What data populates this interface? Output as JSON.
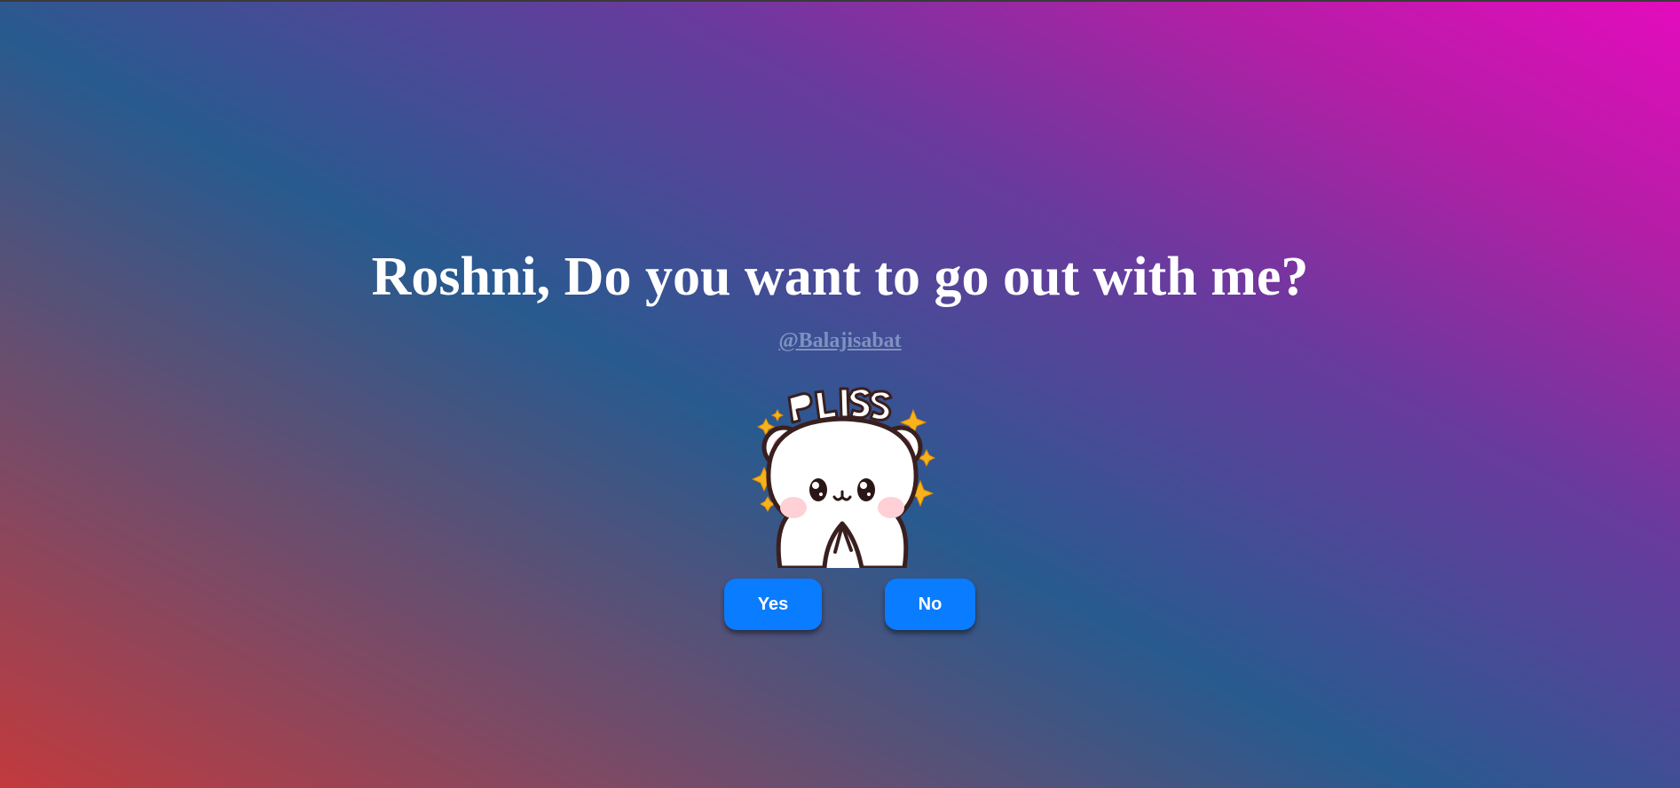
{
  "question": "Roshni, Do you want to go out with me?",
  "handle": "@Balajisabat",
  "sticker": {
    "icon": "bear-pleading-sticker",
    "caption": "PLISS"
  },
  "buttons": {
    "yes_label": "Yes",
    "no_label": "No"
  },
  "colors": {
    "button": "#0a7cff",
    "text": "#ffffff",
    "handle": "#8a9ec8"
  }
}
